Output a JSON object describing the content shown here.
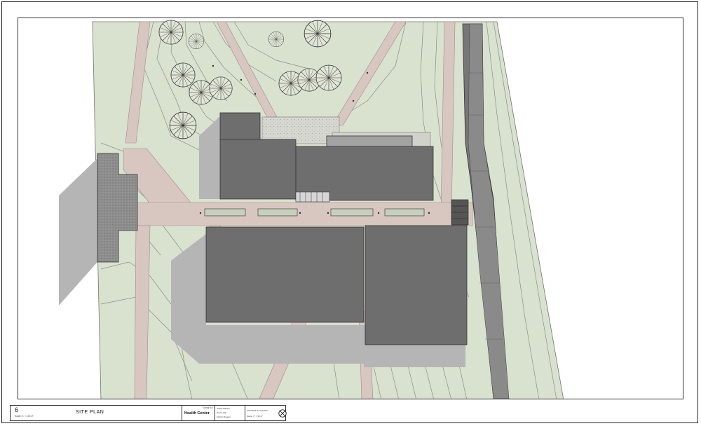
{
  "title_block": {
    "view_number": "6",
    "scale_note": "Scale: 1\" = 30'-0\"",
    "view_title": "SITE PLAN",
    "group_label": "Group 10",
    "project_name": "Health Center",
    "names": [
      "Casey Barnes",
      "Justin Hall",
      "Ashton Rogers"
    ],
    "timestamp": "4/21/2023 8:37:09 PM",
    "scale_small": "Scale: 1\" = 30'-0\""
  },
  "colors": {
    "ground": "#d9e1cf",
    "path": "#d8c6c1",
    "building_dark": "#6e6e6e",
    "building_light": "#a3a3a3",
    "shadow": "#b5b5b5",
    "contour": "#8a8f86",
    "tree": "#444444"
  },
  "icons": {
    "north_arrow": "north-arrow-icon"
  }
}
